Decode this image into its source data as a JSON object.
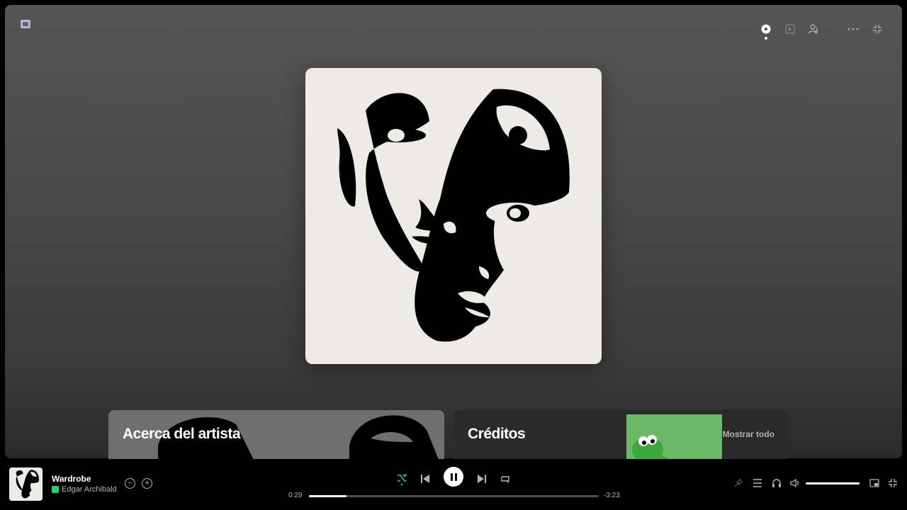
{
  "now_playing": {
    "title": "Wardrobe",
    "artist": "Edgar Archibald",
    "elapsed": "0:29",
    "remaining": "-3:23",
    "progress_fraction": 0.13,
    "volume_fraction": 1.0
  },
  "panels": {
    "about_artist_title": "Acerca del artista",
    "credits_title": "Créditos",
    "credits_show_all": "Mostrar todo"
  },
  "top_bar_icons": [
    "app-icon",
    "now-playing-view-icon",
    "play-queue-icon",
    "friend-activity-icon",
    "more-options-icon",
    "exit-fullscreen-icon"
  ],
  "colors": {
    "accent_green": "#1ed760",
    "cover_background": "#edebe6",
    "stage_top": "#555555"
  }
}
